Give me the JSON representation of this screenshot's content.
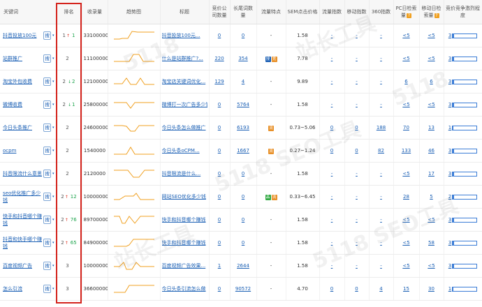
{
  "headers": {
    "keyword": "关键词",
    "rank": "排名",
    "indexed": "收录量",
    "trend": "趋势图",
    "title": "标题",
    "bid_companies": "竞价公司数量",
    "long_tail": "长尾词数量",
    "traffic_feature": "流量特点",
    "sem_price": "SEM点击价格",
    "traffic_index": "流量指数",
    "mobile_index": "移动指数",
    "index_360": "360指数",
    "pc_volume": "PC日检索量",
    "mobile_volume": "移动日检索量",
    "competition": "竞价竞争激烈程度"
  },
  "search_btn": "搜",
  "rows": [
    {
      "keyword": "抖音投放100元",
      "rank": "1",
      "rank_up": "↑",
      "rank_change": "1",
      "rank_down": "",
      "indexed": "33100000",
      "title": "抖音投放100元...",
      "bid": "0",
      "longtail": "0",
      "tags": [],
      "feature": "-",
      "sem": "1.58",
      "traffic": "-",
      "mobile": "-",
      "i360": "-",
      "pc": "<5",
      "mob": "<5",
      "comp": "3",
      "comp_fill": 0.06
    },
    {
      "keyword": "站群推广",
      "rank": "2",
      "rank_up": "",
      "rank_change": "",
      "rank_down": "",
      "indexed": "11100000",
      "title": "什么是站群推广?...",
      "bid": "220",
      "longtail": "354",
      "tags": [
        "搜",
        "竞"
      ],
      "feature": "",
      "sem": "7.78",
      "traffic": "-",
      "mobile": "-",
      "i360": "-",
      "pc": "<5",
      "mob": "<5",
      "comp": "3",
      "comp_fill": 0.06
    },
    {
      "keyword": "淘宝外包收费",
      "rank": "2",
      "rank_up": "",
      "rank_change": "2",
      "rank_down": "↓",
      "indexed": "12100000",
      "title": "淘宝店关键词优化...",
      "bid": "129",
      "longtail": "4",
      "tags": [],
      "feature": "-",
      "sem": "9.89",
      "traffic": "-",
      "mobile": "-",
      "i360": "-",
      "pc": "6",
      "mob": "6",
      "comp": "3",
      "comp_fill": 0.06
    },
    {
      "keyword": "微博收费",
      "rank": "2",
      "rank_up": "",
      "rank_change": "1",
      "rank_down": "↓",
      "indexed": "25800000",
      "title": "微博打一次广告多少钱",
      "bid": "0",
      "longtail": "5764",
      "tags": [],
      "feature": "-",
      "sem": "1.58",
      "traffic": "-",
      "mobile": "-",
      "i360": "-",
      "pc": "<5",
      "mob": "<5",
      "comp": "3",
      "comp_fill": 0.06
    },
    {
      "keyword": "今日头条推广",
      "rank": "2",
      "rank_up": "",
      "rank_change": "",
      "rank_down": "",
      "indexed": "24600000",
      "title": "今日头条怎么做推广",
      "bid": "0",
      "longtail": "6193",
      "tags": [
        "流"
      ],
      "feature": "",
      "sem": "0.73~5.06",
      "traffic": "0",
      "mobile": "0",
      "i360": "188",
      "pc": "70",
      "mob": "13",
      "comp": "1",
      "comp_fill": 0.02
    },
    {
      "keyword": "ocpm",
      "rank": "2",
      "rank_up": "",
      "rank_change": "",
      "rank_down": "",
      "indexed": "1540000",
      "title": "今日头条oCPM...",
      "bid": "0",
      "longtail": "1667",
      "tags": [
        "流"
      ],
      "feature": "",
      "sem": "0.27~1.24",
      "traffic": "0",
      "mobile": "0",
      "i360": "82",
      "pc": "133",
      "mob": "46",
      "comp": "3",
      "comp_fill": 0.06
    },
    {
      "keyword": "抖音限流什么意思",
      "rank": "2",
      "rank_up": "",
      "rank_change": "",
      "rank_down": "",
      "indexed": "2120000",
      "title": "抖音限流是什么...",
      "bid": "0",
      "longtail": "0",
      "tags": [],
      "feature": "-",
      "sem": "1.58",
      "traffic": "-",
      "mobile": "-",
      "i360": "-",
      "pc": "<5",
      "mob": "17",
      "comp": "3",
      "comp_fill": 0.06
    },
    {
      "keyword": "seo优化推广多少钱",
      "rank": "2",
      "rank_up": "↑",
      "rank_change": "12",
      "rank_down": "",
      "indexed": "100000000",
      "title": "网站SEO优化多少钱",
      "bid": "0",
      "longtail": "0",
      "tags": [
        "品",
        "流"
      ],
      "feature": "",
      "sem": "0.33~6.45",
      "traffic": "-",
      "mobile": "-",
      "i360": "-",
      "pc": "28",
      "mob": "5",
      "comp": "2",
      "comp_fill": 0.04
    },
    {
      "keyword": "快手和抖音哪个赚钱",
      "rank": "2",
      "rank_up": "↑",
      "rank_change": "76",
      "rank_down": "",
      "indexed": "89700000",
      "title": "快手和抖音哪个赚钱",
      "bid": "0",
      "longtail": "0",
      "tags": [],
      "feature": "-",
      "sem": "1.58",
      "traffic": "-",
      "mobile": "-",
      "i360": "-",
      "pc": "<5",
      "mob": "<5",
      "comp": "3",
      "comp_fill": 0.06
    },
    {
      "keyword": "抖音和快手哪个赚钱",
      "rank": "2",
      "rank_up": "↑",
      "rank_change": "65",
      "rank_down": "",
      "indexed": "84900000",
      "title": "快手和抖音哪个赚钱",
      "bid": "0",
      "longtail": "0",
      "tags": [],
      "feature": "-",
      "sem": "1.58",
      "traffic": "-",
      "mobile": "-",
      "i360": "-",
      "pc": "<5",
      "mob": "58",
      "comp": "3",
      "comp_fill": 0.06
    },
    {
      "keyword": "百度视频广告",
      "rank": "3",
      "rank_up": "",
      "rank_change": "",
      "rank_down": "",
      "indexed": "100000000",
      "title": "百度视频广告效果...",
      "bid": "1",
      "longtail": "2644",
      "tags": [],
      "feature": "-",
      "sem": "1.58",
      "traffic": "-",
      "mobile": "-",
      "i360": "-",
      "pc": "<5",
      "mob": "<5",
      "comp": "3",
      "comp_fill": 0.06
    },
    {
      "keyword": "怎么引流",
      "rank": "3",
      "rank_up": "",
      "rank_change": "",
      "rank_down": "",
      "indexed": "36600000",
      "title": "今日头条引流怎么做",
      "bid": "0",
      "longtail": "90572",
      "tags": [],
      "feature": "-",
      "sem": "4.70",
      "traffic": "0",
      "mobile": "0",
      "i360": "4",
      "pc": "15",
      "mob": "30",
      "comp": "1",
      "comp_fill": 0.02
    }
  ],
  "watermarks": [
    "5118",
    "站长工具",
    "5118 SEO工具",
    "5118",
    "站长工具",
    "5118 SEO工具"
  ],
  "colors": {
    "accent": "#1a5fb4",
    "highlight": "#d4231c",
    "trend": "#f0a020",
    "tag_blue": "#1a5fb4",
    "tag_orange": "#e8912a",
    "tag_green": "#33aa44"
  }
}
